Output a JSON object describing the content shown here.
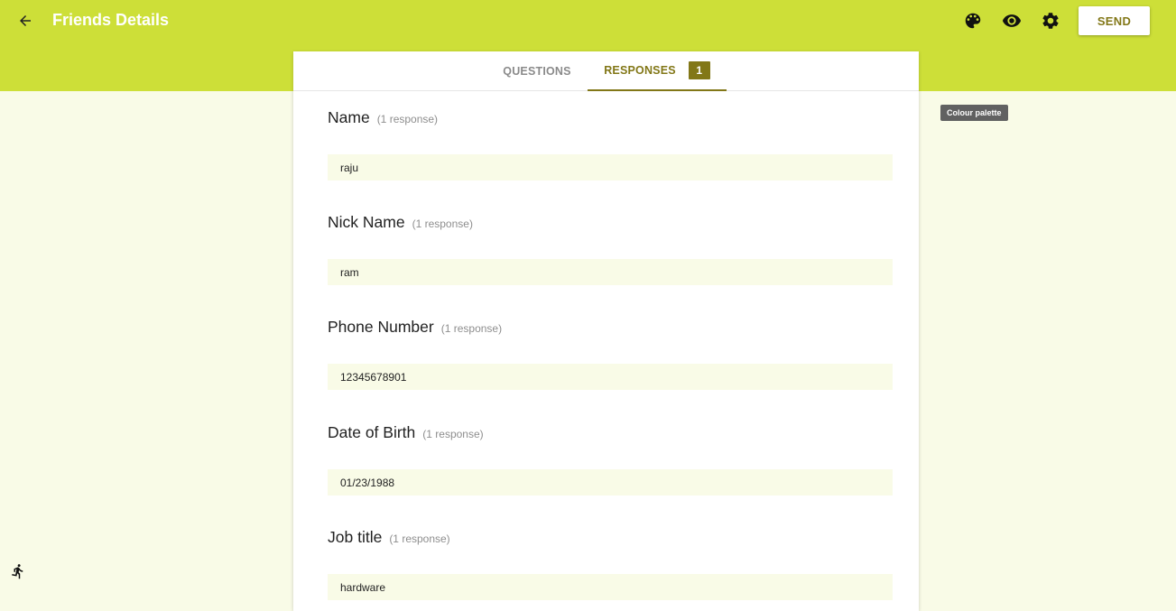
{
  "header": {
    "title": "Friends Details",
    "back_icon": "arrow-left-icon",
    "icons": [
      "palette-icon",
      "eye-icon",
      "gear-icon"
    ],
    "send_label": "SEND",
    "bar_color": "#cddf38",
    "accent_color": "#827717"
  },
  "tabs": [
    {
      "label": "QUESTIONS",
      "active": false
    },
    {
      "label": "RESPONSES",
      "active": true,
      "badge": "1"
    }
  ],
  "tooltip": "Colour palette",
  "questions": [
    {
      "label": "Name",
      "count": "(1 response)",
      "answer": "raju"
    },
    {
      "label": "Nick Name",
      "count": "(1 response)",
      "answer": "ram"
    },
    {
      "label": "Phone Number",
      "count": "(1 response)",
      "answer": "12345678901"
    },
    {
      "label": "Date of Birth",
      "count": "(1 response)",
      "answer": "01/23/1988"
    },
    {
      "label": "Job title",
      "count": "(1 response)",
      "answer": "hardware"
    }
  ],
  "accessibility_icon": "running-person-icon"
}
